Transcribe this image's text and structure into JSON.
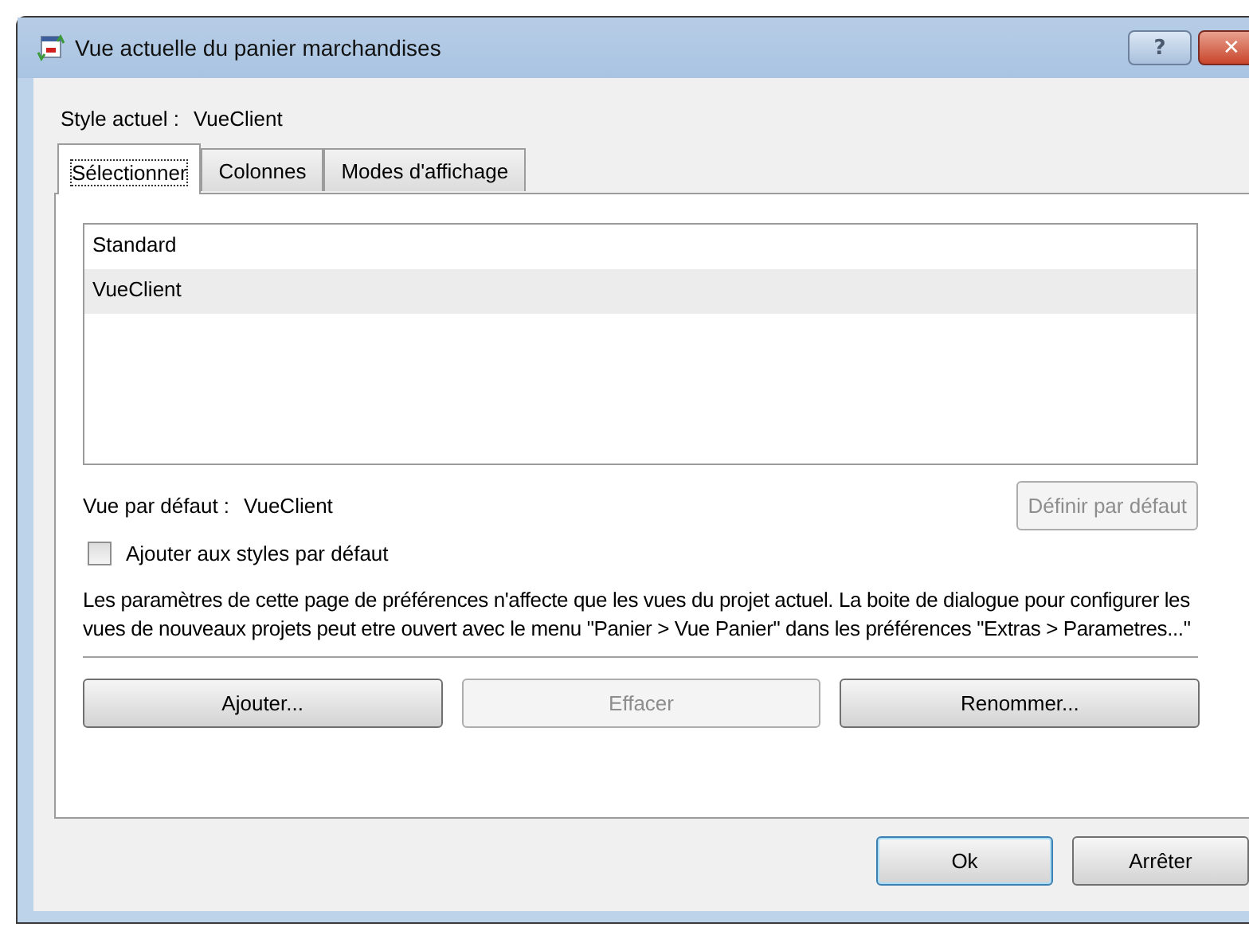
{
  "window": {
    "title": "Vue actuelle du panier marchandises",
    "help_button": "?",
    "close_button": "✕"
  },
  "current_style": {
    "label": "Style actuel :",
    "value": "VueClient"
  },
  "tabs": [
    {
      "label": "Sélectionner",
      "selected": true
    },
    {
      "label": "Colonnes",
      "selected": false
    },
    {
      "label": "Modes d'affichage",
      "selected": false
    }
  ],
  "views": [
    {
      "name": "Standard",
      "selected": false
    },
    {
      "name": "VueClient",
      "selected": true
    }
  ],
  "default_view": {
    "label": "Vue par défaut :",
    "value": "VueClient",
    "button": {
      "label": "Définir par défaut",
      "disabled": true
    }
  },
  "add_to_default": {
    "label": "Ajouter aux styles par défaut",
    "checked": false
  },
  "info": "Les paramètres de cette page de préférences n'affecte que les vues du projet actuel. La boite de dialogue pour configurer les vues de nouveaux projets peut etre ouvert avec le menu \"Panier > Vue Panier\" dans les préférences \"Extras > Parametres...\"",
  "actions": [
    {
      "label": "Ajouter...",
      "disabled": false
    },
    {
      "label": "Effacer",
      "disabled": true
    },
    {
      "label": "Renommer...",
      "disabled": false
    }
  ],
  "footer_buttons": [
    {
      "label": "Ok",
      "default": true
    },
    {
      "label": "Arrêter",
      "default": false
    }
  ]
}
